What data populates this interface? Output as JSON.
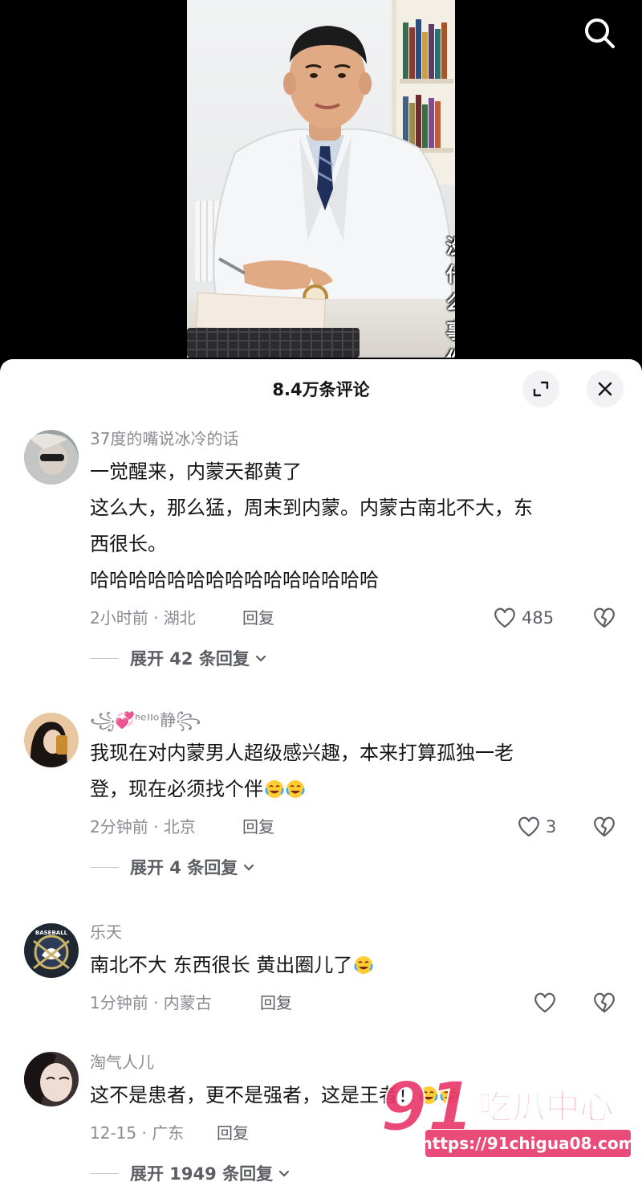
{
  "video": {
    "caption": "没什么事你呢"
  },
  "sheet": {
    "title": "8.4万条评论"
  },
  "comments": [
    {
      "username": "37度的嘴说冰冷的话",
      "lines": [
        "一觉醒来，内蒙天都黄了",
        "这么大，那么猛，周末到内蒙。内蒙古南北不大，东",
        "西很长。",
        "哈哈哈哈哈哈哈哈哈哈哈哈哈哈哈"
      ],
      "time": "2小时前 · 湖北",
      "reply_label": "回复",
      "likes": "485",
      "expand_label": "展开 42 条回复"
    },
    {
      "username": "꧁💞ᑋᵉᑊᑊᵒ静꧂",
      "lines": [
        "我现在对内蒙男人超级感兴趣，本来打算孤独一老",
        "登，现在必须找个伴"
      ],
      "time": "2分钟前 · 北京",
      "reply_label": "回复",
      "likes": "3",
      "expand_label": "展开 4 条回复"
    },
    {
      "username": "乐天",
      "lines": [
        "南北不大 东西很长 黄出圈儿了"
      ],
      "time": "1分钟前 · 内蒙古",
      "reply_label": "回复",
      "likes": ""
    },
    {
      "username": "淘气人儿",
      "lines": [
        "这不是患者，更不是强者，这是王者！"
      ],
      "time": "12-15 · 广东",
      "reply_label": "回复",
      "likes": "",
      "expand_label": "展开 1949 条回复"
    }
  ],
  "watermark": {
    "logo": "91吃瓜中心",
    "url": "https://91chigua08.com"
  },
  "colors": {
    "accent_pink": "#e8386b",
    "text_primary": "#161616",
    "text_secondary": "#8a8b91"
  }
}
